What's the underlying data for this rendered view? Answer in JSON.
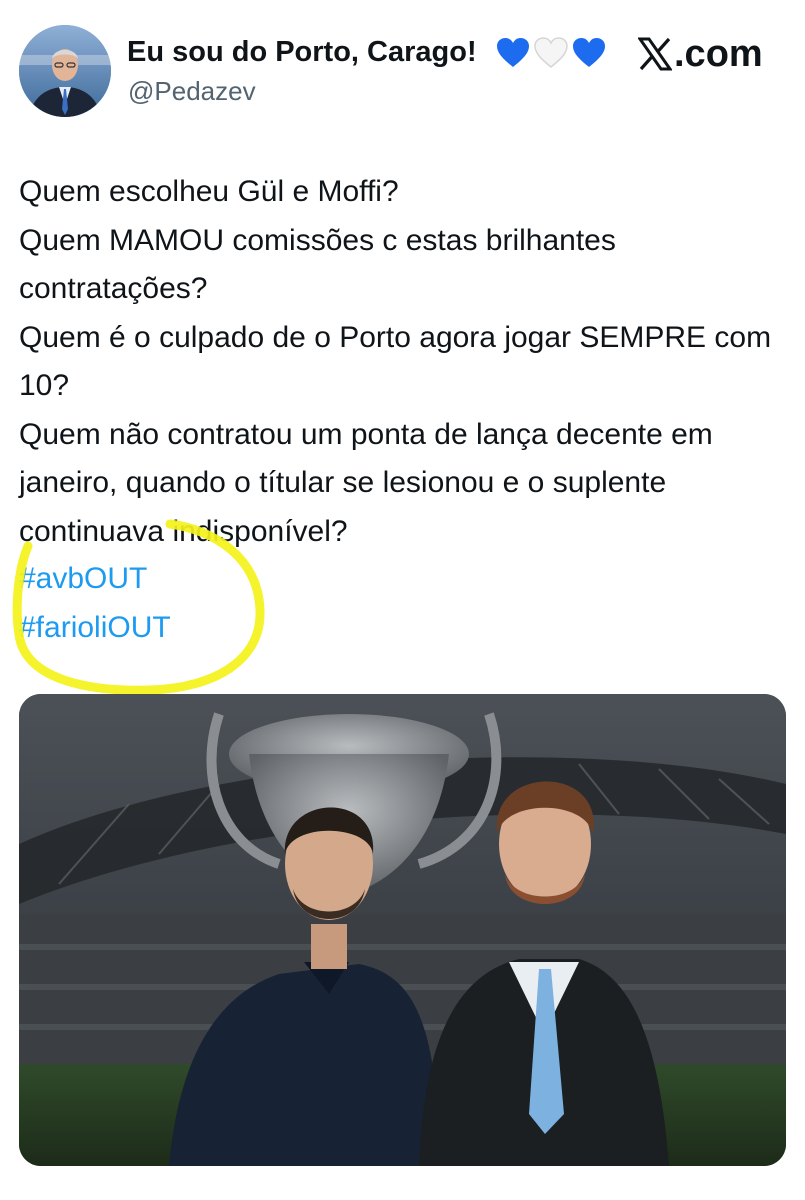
{
  "author": {
    "display_name": "Eu sou do Porto, Carago!",
    "handle": "@Pedazev",
    "hearts": [
      "blue-heart",
      "white-heart",
      "blue-heart"
    ]
  },
  "brand": {
    "label": ".com",
    "logo": "x-logo-icon"
  },
  "tweet": {
    "text": "Quem escolheu Gül e Moffi?\nQuem MAMOU comissões c estas brilhantes contratações?\nQuem é o culpado de o Porto agora jogar SEMPRE com 10?\nQuem não contratou um ponta de lança decente em janeiro, quando o títular se lesionou e o suplente continuava indisponível?",
    "hashtags": [
      "#avbOUT",
      "#farioliOUT"
    ]
  },
  "colors": {
    "hashtag": "#1d9bf0",
    "handle": "#536471",
    "highlight": "#f4f21a",
    "heart_blue": "#1d6cf0"
  }
}
